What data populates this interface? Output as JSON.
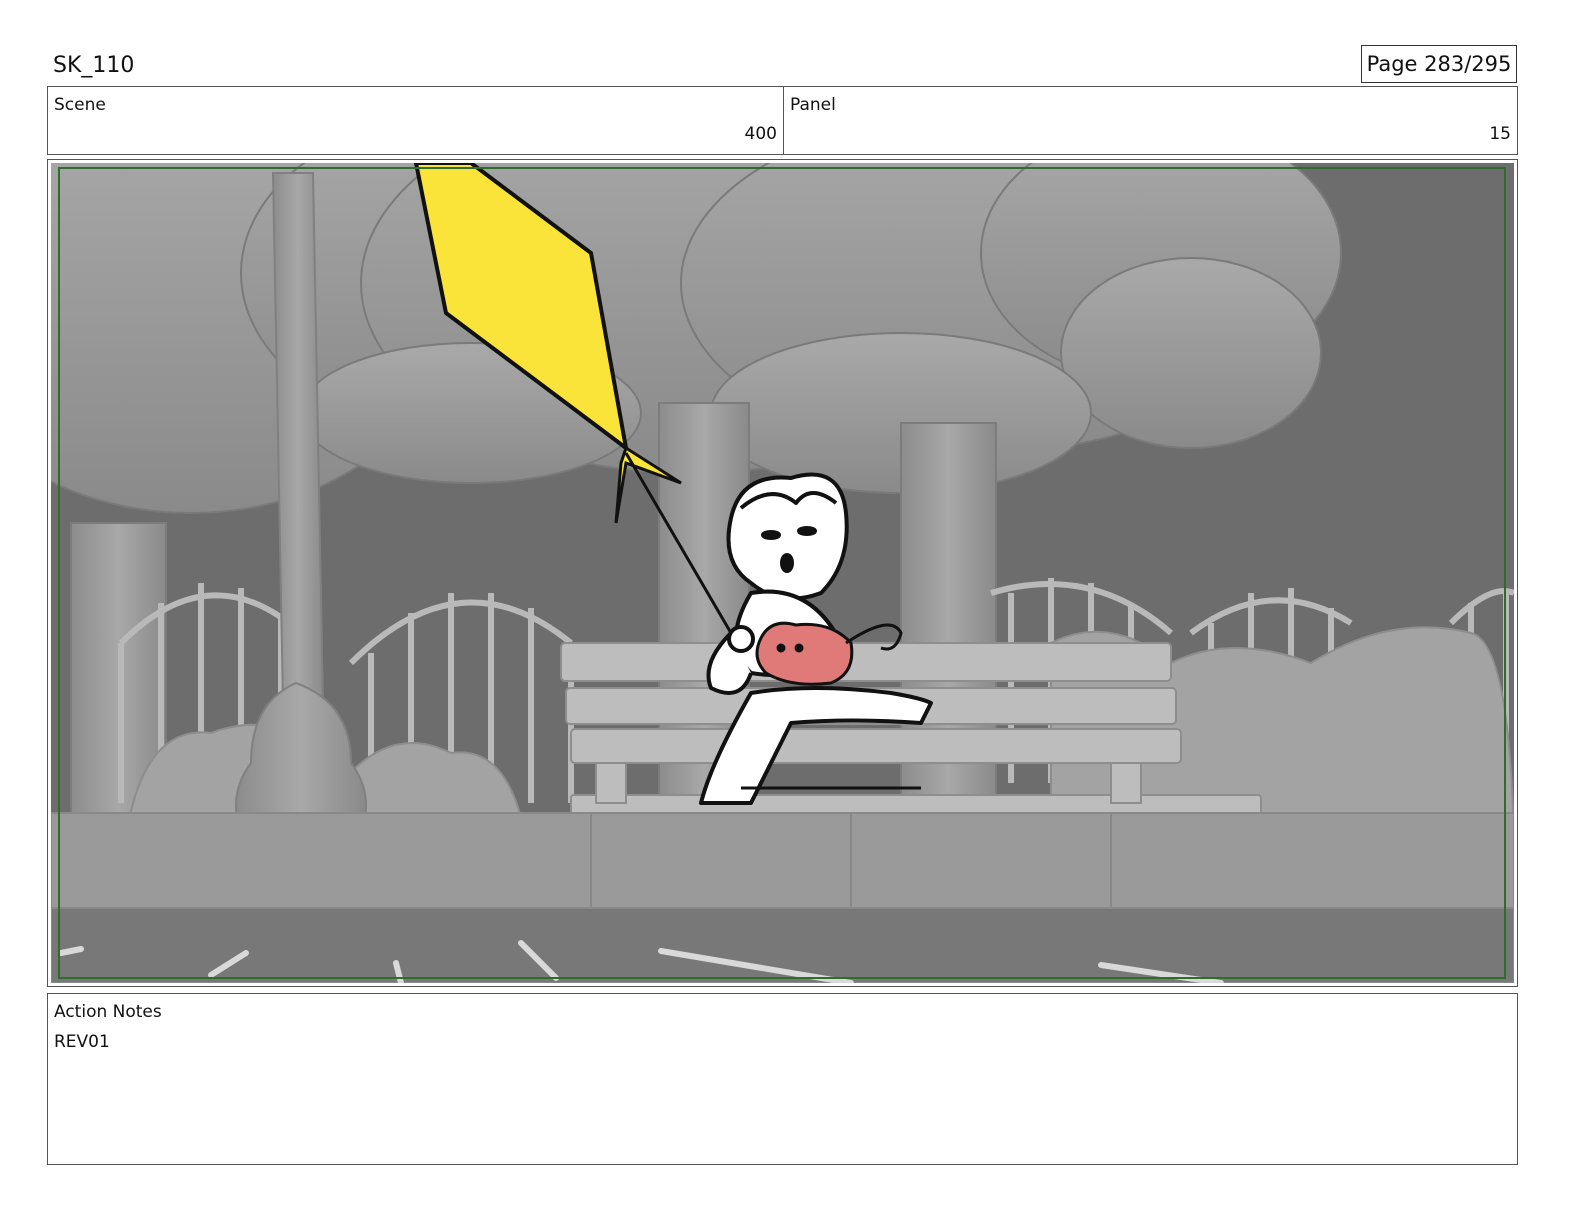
{
  "header": {
    "sequence_id": "SK_110",
    "page_label": "Page 283/295"
  },
  "scene": {
    "label": "Scene",
    "value": "400"
  },
  "panel": {
    "label": "Panel",
    "value": "15"
  },
  "notes": {
    "label": "Action Notes",
    "text": "REV01"
  },
  "colors": {
    "kite": "#fbe43a",
    "cat": "#e07a78",
    "safe_frame": "#2f6d2f",
    "background_gray": "#6e6e6e"
  }
}
